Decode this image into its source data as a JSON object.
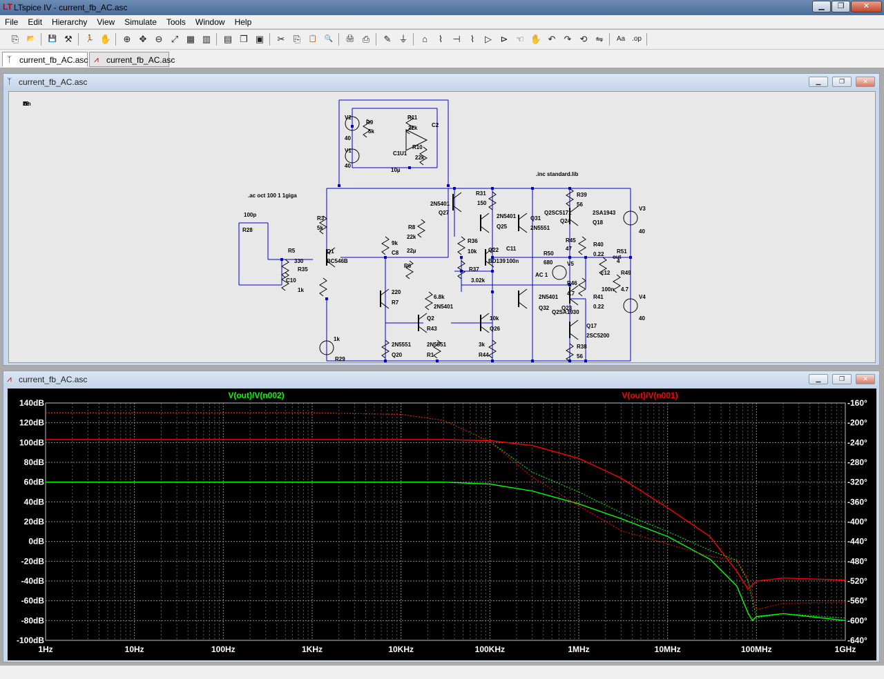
{
  "app": {
    "title": "LTspice IV - current_fb_AC.asc"
  },
  "menu": [
    "File",
    "Edit",
    "Hierarchy",
    "View",
    "Simulate",
    "Tools",
    "Window",
    "Help"
  ],
  "toolbar": [
    {
      "icon": "new-schematic-icon",
      "glyph": "⎘"
    },
    {
      "icon": "open-icon",
      "glyph": "📂"
    },
    {
      "icon": "save-icon",
      "glyph": "💾"
    },
    {
      "icon": "control-panel-icon",
      "glyph": "⚒"
    },
    {
      "icon": "run-icon",
      "glyph": "🏃"
    },
    {
      "icon": "halt-icon",
      "glyph": "✋"
    },
    {
      "icon": "zoom-in-icon",
      "glyph": "⊕"
    },
    {
      "icon": "pan-icon",
      "glyph": "✥"
    },
    {
      "icon": "zoom-out-icon",
      "glyph": "⊖"
    },
    {
      "icon": "zoom-fit-icon",
      "glyph": "⤢"
    },
    {
      "icon": "autorange-icon",
      "glyph": "▦"
    },
    {
      "icon": "grid-icon",
      "glyph": "▥"
    },
    {
      "icon": "tile-horizontal-icon",
      "glyph": "▤"
    },
    {
      "icon": "cascade-icon",
      "glyph": "❐"
    },
    {
      "icon": "close-windows-icon",
      "glyph": "▣"
    },
    {
      "icon": "cut-icon",
      "glyph": "✂"
    },
    {
      "icon": "copy-icon",
      "glyph": "⎘"
    },
    {
      "icon": "paste-icon",
      "glyph": "📋"
    },
    {
      "icon": "find-icon",
      "glyph": "🔍"
    },
    {
      "icon": "print-setup-icon",
      "glyph": "🖨"
    },
    {
      "icon": "print-icon",
      "glyph": "⎙"
    },
    {
      "icon": "wire-icon",
      "glyph": "✎"
    },
    {
      "icon": "ground-icon",
      "glyph": "⏚"
    },
    {
      "icon": "label-net-icon",
      "glyph": "⌂"
    },
    {
      "icon": "resistor-icon",
      "glyph": "⌇"
    },
    {
      "icon": "capacitor-icon",
      "glyph": "⊣"
    },
    {
      "icon": "inductor-icon",
      "glyph": "⌇"
    },
    {
      "icon": "diode-icon",
      "glyph": "▷"
    },
    {
      "icon": "component-icon",
      "glyph": "⊳"
    },
    {
      "icon": "move-icon",
      "glyph": "☜"
    },
    {
      "icon": "drag-icon",
      "glyph": "✋"
    },
    {
      "icon": "undo-icon",
      "glyph": "↶"
    },
    {
      "icon": "redo-icon",
      "glyph": "↷"
    },
    {
      "icon": "rotate-icon",
      "glyph": "⟲"
    },
    {
      "icon": "mirror-icon",
      "glyph": "⇋"
    },
    {
      "icon": "text-icon",
      "glyph": "Aa"
    },
    {
      "icon": "spice-directive-icon",
      "glyph": ".op"
    }
  ],
  "tabs": [
    {
      "label": "current_fb_AC.asc",
      "kind": "schematic",
      "active": true
    },
    {
      "label": "current_fb_AC.asc",
      "kind": "waveform",
      "active": false
    }
  ],
  "schematic": {
    "window_title": "current_fb_AC.asc",
    "directives": [
      ".ac oct 100 1 1giga",
      ".inc standard.lib"
    ],
    "labels": [
      "V2",
      "40",
      "V1",
      "40",
      "R9",
      "5k",
      "R11",
      "22k",
      "C2",
      "C1",
      "10µ",
      "U1",
      "R10",
      "22k",
      "2N5401",
      "Q27",
      "R31",
      "150",
      "2N5401",
      "Q25",
      "R8",
      "22k",
      "Q31",
      "2N5551",
      "Q2SC5171",
      "Q24",
      "2SA1943",
      "Q18",
      "R39",
      "56",
      "V3",
      "40",
      "R36",
      "10k",
      "Q22",
      "C11",
      "100n",
      "BD139",
      "R45",
      "47",
      "R50",
      "680",
      "R40",
      "0.22",
      "out",
      "R51",
      "4",
      "c12",
      "100n",
      "R49",
      "4.7",
      "V4",
      "40",
      "AC 1",
      "V5",
      "R46",
      "4.7",
      "R41",
      "0.22",
      "2N5401",
      "Q32",
      "Q23",
      "Q2SA1930",
      "Q17",
      "2SC5200",
      "R38",
      "56",
      "R37",
      "3.02k",
      "R3",
      "5k",
      "Q1",
      "BC546B",
      "R5",
      "330",
      "R35",
      "1k",
      "C10",
      "100p",
      "R28",
      "9k",
      "C8",
      "22µ",
      "R6",
      "220",
      "R7",
      "6.8k",
      "2N5401",
      "Q2",
      "R43",
      "10k",
      "Q26",
      "2N5551",
      "Q20",
      "2N5551",
      "R1",
      "3k",
      "R44",
      "1k",
      "R29",
      "22",
      "I1",
      "1m"
    ]
  },
  "waveform": {
    "window_title": "current_fb_AC.asc",
    "traces": [
      {
        "label": "V(out)/V(n002)",
        "color": "#00ff00"
      },
      {
        "label": "V(out)/V(n001)",
        "color": "#ff0000"
      }
    ],
    "axes": {
      "x_ticks": [
        "1Hz",
        "10Hz",
        "100Hz",
        "1KHz",
        "10KHz",
        "100KHz",
        "1MHz",
        "10MHz",
        "100MHz",
        "1GHz"
      ],
      "y_left_ticks": [
        "140dB",
        "120dB",
        "100dB",
        "80dB",
        "60dB",
        "40dB",
        "20dB",
        "0dB",
        "-20dB",
        "-40dB",
        "-60dB",
        "-80dB",
        "-100dB"
      ],
      "y_right_ticks": [
        "-160°",
        "-200°",
        "-240°",
        "-280°",
        "-320°",
        "-360°",
        "-400°",
        "-440°",
        "-480°",
        "-520°",
        "-560°",
        "-600°",
        "-640°"
      ]
    }
  },
  "chart_data": {
    "type": "line",
    "x_scale": "log",
    "xlim": [
      1,
      1000000000
    ],
    "ylim": [
      -100,
      140
    ],
    "y2lim": [
      -640,
      -160
    ],
    "xlabel": "",
    "ylabel": "",
    "grid": true,
    "series": [
      {
        "name": "V(out)/V(n002)",
        "color": "#00ff00",
        "style": "solid",
        "axis": "gain",
        "x": [
          1,
          1000,
          30000,
          100000,
          300000,
          1000000,
          3000000,
          10000000,
          30000000,
          60000000,
          80000000,
          90000000,
          100000000,
          200000000,
          1000000000
        ],
        "y": [
          60,
          60,
          60,
          58,
          51,
          38,
          23,
          5,
          -18,
          -45,
          -72,
          -80,
          -76,
          -73,
          -80
        ]
      },
      {
        "name": "V(out)/V(n002)",
        "color": "#00ff00",
        "style": "dotted",
        "axis": "phase",
        "x": [
          1,
          1000,
          10000,
          30000,
          100000,
          300000,
          1000000,
          3000000,
          10000000,
          30000000,
          60000000,
          80000000,
          100000000,
          200000000,
          1000000000
        ],
        "y": [
          -180,
          -180,
          -183,
          -195,
          -238,
          -300,
          -340,
          -382,
          -420,
          -458,
          -478,
          -520,
          -594,
          -586,
          -595
        ]
      },
      {
        "name": "V(out)/V(n001)",
        "color": "#ff0000",
        "style": "solid",
        "axis": "gain",
        "x": [
          1,
          1000,
          30000,
          100000,
          300000,
          1000000,
          3000000,
          10000000,
          30000000,
          60000000,
          80000000,
          100000000,
          200000000,
          1000000000
        ],
        "y": [
          103,
          103,
          103,
          102,
          97,
          84,
          64,
          34,
          5,
          -30,
          -48,
          -40,
          -37,
          -39
        ]
      },
      {
        "name": "V(out)/V(n001)",
        "color": "#ff0000",
        "style": "dotted",
        "axis": "phase",
        "x": [
          1,
          1000,
          10000,
          30000,
          100000,
          300000,
          1000000,
          3000000,
          10000000,
          30000000,
          60000000,
          80000000,
          100000000,
          200000000,
          1000000000
        ],
        "y": [
          -180,
          -180,
          -183,
          -195,
          -238,
          -310,
          -368,
          -418,
          -445,
          -470,
          -478,
          -515,
          -578,
          -565,
          -563
        ]
      }
    ]
  }
}
